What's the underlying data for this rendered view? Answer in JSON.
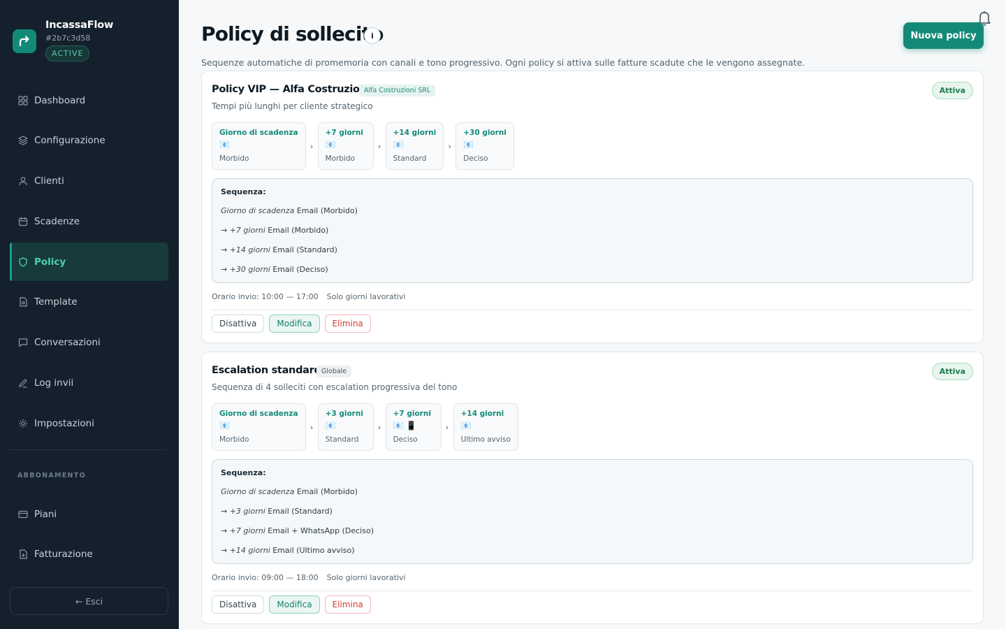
{
  "brand": {
    "name": "IncassaFlow",
    "id": "#2b7c3d58",
    "status": "ACTIVE"
  },
  "nav": [
    {
      "label": "Dashboard",
      "icon": "grid-icon"
    },
    {
      "label": "Configurazione",
      "icon": "layers-icon"
    },
    {
      "label": "Clienti",
      "icon": "user-icon"
    },
    {
      "label": "Scadenze",
      "icon": "calendar-icon"
    },
    {
      "label": "Policy",
      "icon": "shield-icon",
      "active": true
    },
    {
      "label": "Template",
      "icon": "document-icon"
    },
    {
      "label": "Conversazioni",
      "icon": "chat-icon"
    },
    {
      "label": "Log invii",
      "icon": "pencil-icon"
    },
    {
      "label": "Impostazioni",
      "icon": "gear-icon"
    }
  ],
  "subscription": {
    "label": "ABBONAMENTO",
    "items": [
      {
        "label": "Piani",
        "icon": "card-icon"
      },
      {
        "label": "Fatturazione",
        "icon": "invoice-icon"
      }
    ]
  },
  "logout_label": "← Esci",
  "page": {
    "title": "Policy di sollecito",
    "info": "i",
    "new_button": "Nuova policy",
    "subtitle": "Sequenze automatiche di promemoria con canali e tono progressivo. Ogni policy si attiva sulle fatture scadute che le vengono assegnate."
  },
  "policies": [
    {
      "name": "Policy VIP — Alfa Costruzioni",
      "tag": "Alfa Costruzioni SRL",
      "status": "Attiva",
      "description": "Tempi più lunghi per cliente strategico",
      "steps": [
        {
          "when": "Giorno di scadenza",
          "channels": "📧",
          "tone": "Morbido"
        },
        {
          "when": "+7 giorni",
          "channels": "📧",
          "tone": "Morbido"
        },
        {
          "when": "+14 giorni",
          "channels": "📧",
          "tone": "Standard"
        },
        {
          "when": "+30 giorni",
          "channels": "📧",
          "tone": "Deciso"
        }
      ],
      "sequence_title": "Sequenza:",
      "sequence": [
        {
          "prefix": "",
          "when": "Giorno di scadenza",
          "text": "Email (Morbido)"
        },
        {
          "prefix": "→ ",
          "when": "+7 giorni",
          "text": "Email (Morbido)"
        },
        {
          "prefix": "→ ",
          "when": "+14 giorni",
          "text": "Email (Standard)"
        },
        {
          "prefix": "→ ",
          "when": "+30 giorni",
          "text": "Email (Deciso)"
        }
      ],
      "schedule": "Orario invio: 10:00 — 17:00",
      "workdays": "Solo giorni lavorativi",
      "actions": {
        "disable": "Disattiva",
        "edit": "Modifica",
        "delete": "Elimina"
      }
    },
    {
      "name": "Escalation standard",
      "tag": "Globale",
      "status": "Attiva",
      "description": "Sequenza di 4 solleciti con escalation progressiva del tono",
      "steps": [
        {
          "when": "Giorno di scadenza",
          "channels": "📧",
          "tone": "Morbido"
        },
        {
          "when": "+3 giorni",
          "channels": "📧",
          "tone": "Standard"
        },
        {
          "when": "+7 giorni",
          "channels": "📧 📱",
          "tone": "Deciso"
        },
        {
          "when": "+14 giorni",
          "channels": "📧",
          "tone": "Ultimo avviso"
        }
      ],
      "sequence_title": "Sequenza:",
      "sequence": [
        {
          "prefix": "",
          "when": "Giorno di scadenza",
          "text": "Email (Morbido)"
        },
        {
          "prefix": "→ ",
          "when": "+3 giorni",
          "text": "Email (Standard)"
        },
        {
          "prefix": "→ ",
          "when": "+7 giorni",
          "text": "Email + WhatsApp (Deciso)"
        },
        {
          "prefix": "→ ",
          "when": "+14 giorni",
          "text": "Email (Ultimo avviso)"
        }
      ],
      "schedule": "Orario invio: 09:00 — 18:00",
      "workdays": "Solo giorni lavorativi",
      "actions": {
        "disable": "Disattiva",
        "edit": "Modifica",
        "delete": "Elimina"
      }
    }
  ],
  "colors": {
    "sidebar": "#14212d",
    "accent": "#138a78",
    "active_text": "#4fd1b8",
    "danger": "#d03a3a",
    "success": "#1d7a4e"
  }
}
